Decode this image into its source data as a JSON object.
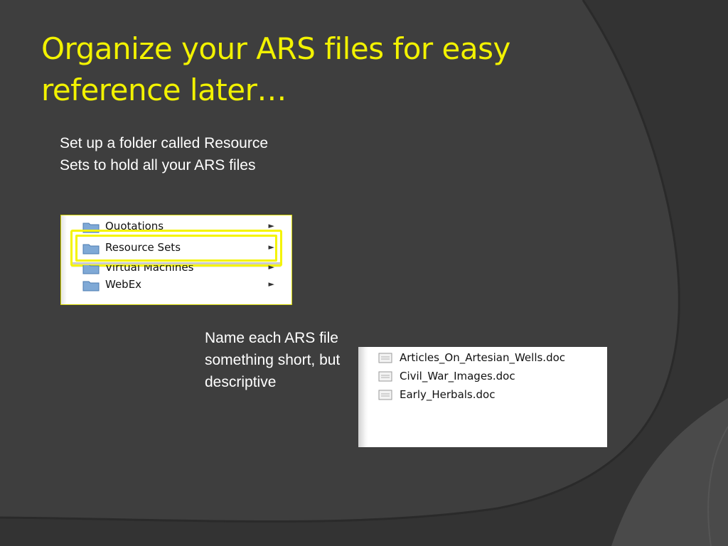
{
  "slide": {
    "title": "Organize your ARS files for easy reference later…",
    "text1": "Set up a folder called Resource Sets to hold all your ARS files",
    "text2": "Name each ARS file something short, but descriptive"
  },
  "menu_screenshot": {
    "items": [
      {
        "label": "Quotations",
        "icon": "folder-icon",
        "arrow": "►"
      },
      {
        "label": "Resource Sets",
        "icon": "folder-icon",
        "arrow": "►",
        "highlighted": true
      },
      {
        "label": "Virtual Machines",
        "icon": "folder-icon",
        "arrow": "►"
      },
      {
        "label": "WebEx",
        "icon": "folder-icon",
        "arrow": "►"
      }
    ],
    "highlight_color": "#f4f400"
  },
  "files_screenshot": {
    "files": [
      {
        "name": "Articles_On_Artesian_Wells.doc",
        "icon": "document-icon"
      },
      {
        "name": "Civil_War_Images.doc",
        "icon": "document-icon"
      },
      {
        "name": "Early_Herbals.doc",
        "icon": "document-icon"
      }
    ]
  },
  "colors": {
    "background": "#3b3b3b",
    "title": "#f2f200",
    "body_text": "#ffffff"
  }
}
